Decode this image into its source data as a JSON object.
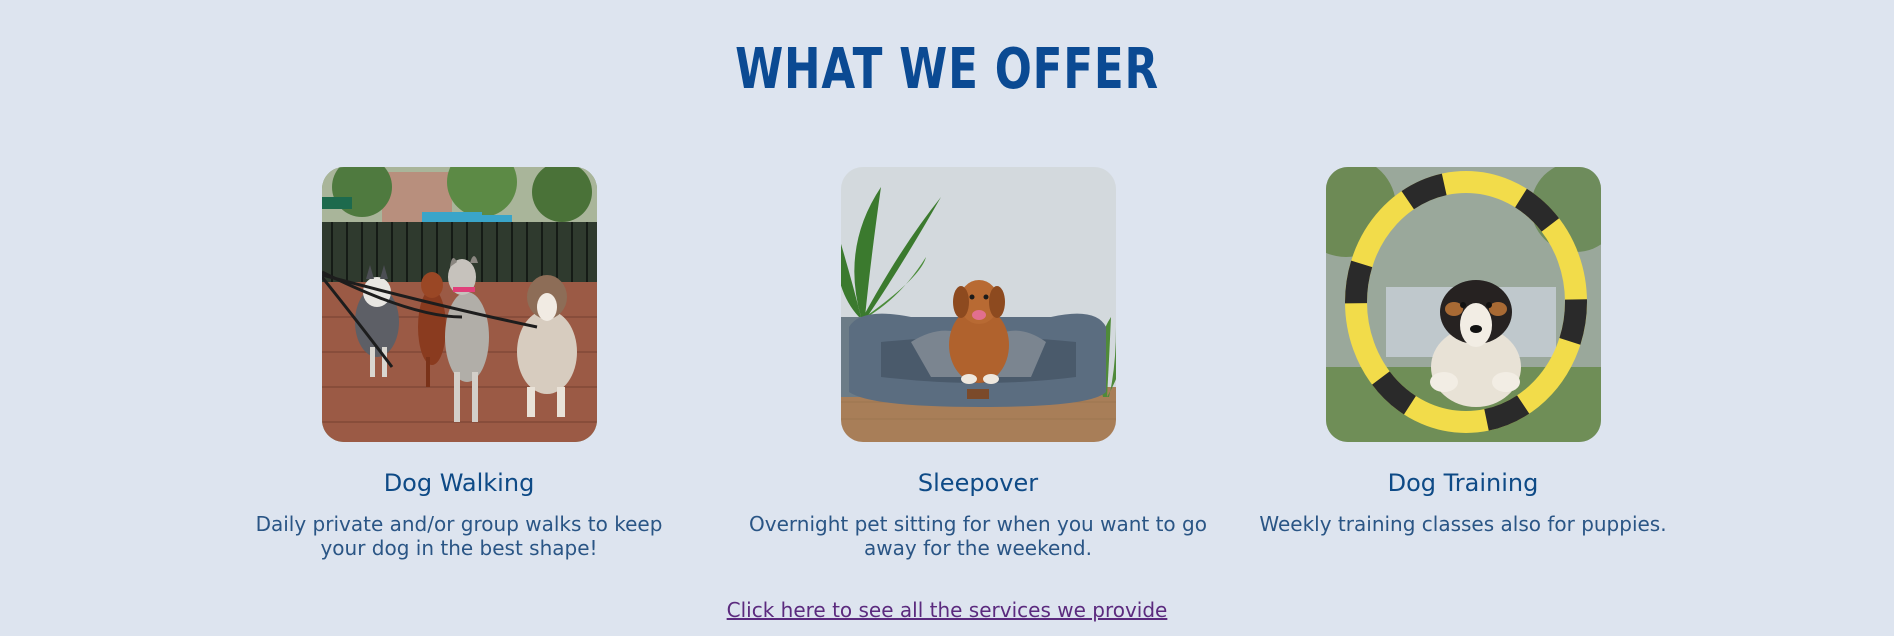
{
  "section": {
    "title": "WHAT WE OFFER"
  },
  "services": [
    {
      "title": "Dog Walking",
      "description": "Daily private and/or group walks to keep your dog in the best shape!",
      "image": "dogs-on-leash-photo"
    },
    {
      "title": "Sleepover",
      "description": "Overnight pet sitting for when you want to go away for the weekend.",
      "image": "dog-in-bed-photo"
    },
    {
      "title": "Dog Training",
      "description": "Weekly training classes also for puppies.",
      "image": "dog-jumping-through-hoop-photo"
    }
  ],
  "footer_link": {
    "label": "Click here to see all the services we provide"
  },
  "colors": {
    "background": "#dde4ef",
    "heading": "#0b4a93",
    "card_title": "#0e4a86",
    "body_text": "#2a5585",
    "link": "#5b2a7e"
  }
}
